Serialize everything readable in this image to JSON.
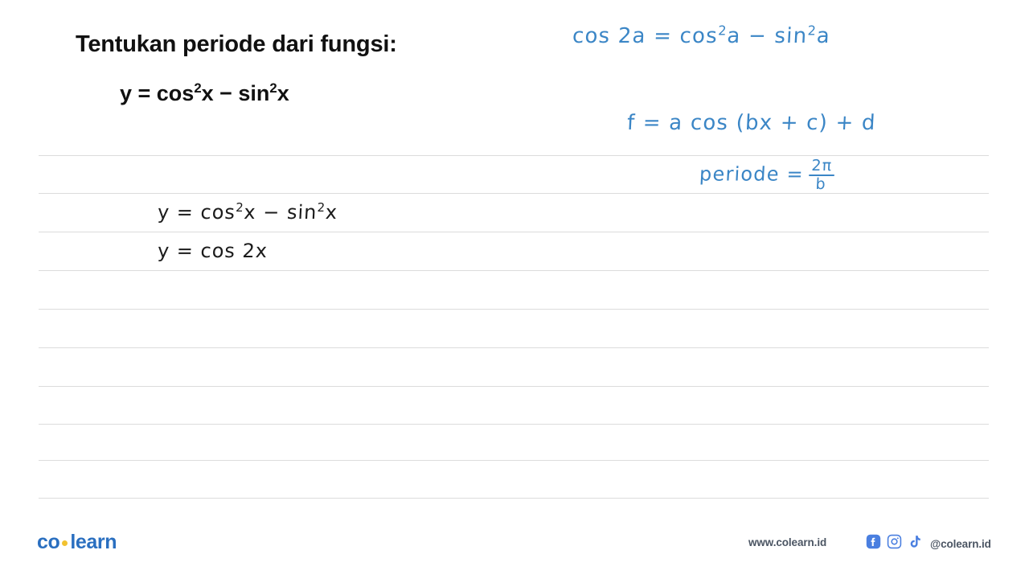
{
  "question": {
    "prompt": "Tentukan periode dari fungsi:",
    "equation_lhs": "y = cos",
    "equation_sup1": "2",
    "equation_mid": "x − sin",
    "equation_sup2": "2",
    "equation_end": "x"
  },
  "notes": {
    "identity": {
      "lhs": "cos 2a = cos",
      "sup1": "2",
      "mid": "a − sin",
      "sup2": "2",
      "end": "a"
    },
    "general_form": "f  =   a  cos (bx + c) + d",
    "period_label": "periode =",
    "period_numerator": "2π",
    "period_denominator": "b"
  },
  "work": {
    "line1": {
      "lhs": "y  =  cos",
      "sup1": "2",
      "mid": "x  −  sin",
      "sup2": "2",
      "end": "x"
    },
    "line2": "y  =   cos 2x"
  },
  "paper": {
    "rule_color": "#dcdcdc",
    "rule_y_positions": [
      193,
      240,
      288,
      336,
      384,
      432,
      480,
      527,
      572,
      619
    ]
  },
  "footer": {
    "logo_part1": "co",
    "logo_part2": "learn",
    "website": "www.colearn.id",
    "handle": "@colearn.id",
    "icons": [
      "facebook-icon",
      "instagram-icon",
      "tiktok-icon"
    ]
  },
  "colors": {
    "ink_blue": "#3b86c6",
    "ink_black": "#1b1b1b",
    "brand_blue": "#2a6fc0",
    "brand_yellow": "#f2c230",
    "footer_gray": "#4b5563"
  }
}
